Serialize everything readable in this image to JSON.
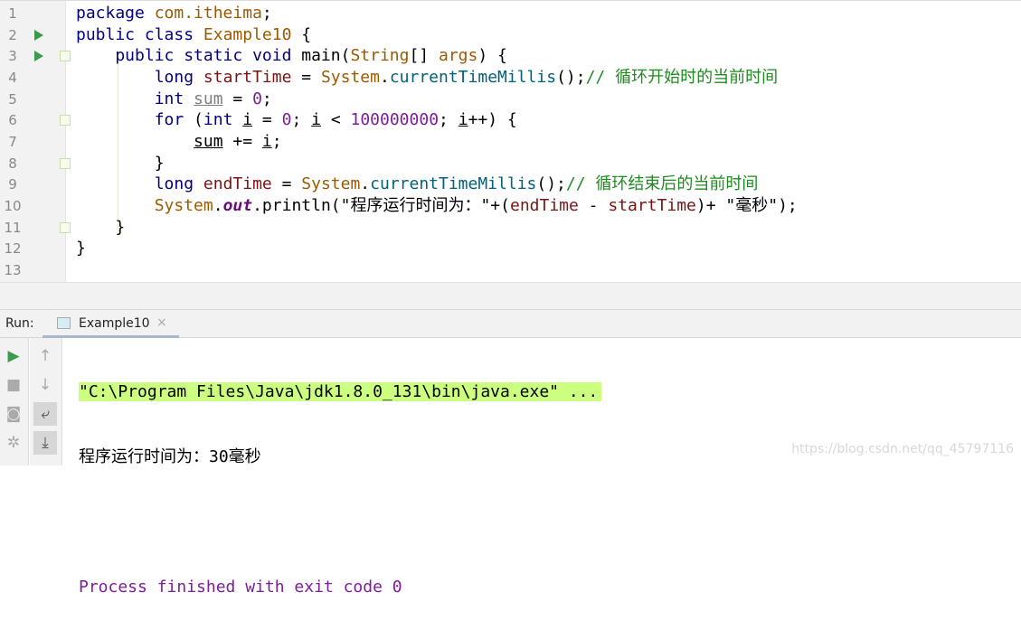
{
  "editor": {
    "line_numbers": [
      "1",
      "2",
      "3",
      "4",
      "5",
      "6",
      "7",
      "8",
      "9",
      "10",
      "11",
      "12",
      "13"
    ],
    "run_gutter_lines": [
      2,
      3
    ],
    "fold_lines": [
      3,
      6,
      8,
      11
    ],
    "lines": [
      [
        [
          "package ",
          "keyword"
        ],
        [
          "com.itheima",
          "type"
        ],
        [
          ";",
          "plain"
        ]
      ],
      [
        [
          "public class ",
          "keyword"
        ],
        [
          "Example10",
          "type"
        ],
        [
          " {",
          "plain"
        ]
      ],
      [
        [
          "    public static void ",
          "keyword"
        ],
        [
          "main(",
          "plain"
        ],
        [
          "String",
          "type"
        ],
        [
          "[] ",
          "plain"
        ],
        [
          "args",
          "type"
        ],
        [
          ") {",
          "plain"
        ]
      ],
      [
        [
          "        long ",
          "keyword"
        ],
        [
          "startTime",
          "var"
        ],
        [
          " = ",
          "plain"
        ],
        [
          "System",
          "type"
        ],
        [
          ".",
          "plain"
        ],
        [
          "currentTimeMillis",
          "method"
        ],
        [
          "();",
          "plain"
        ],
        [
          "// 循环开始时的当前时间",
          "comment"
        ]
      ],
      [
        [
          "        int ",
          "keyword"
        ],
        [
          "sum",
          "unused"
        ],
        [
          " = ",
          "plain"
        ],
        [
          "0",
          "num"
        ],
        [
          ";",
          "plain"
        ]
      ],
      [
        [
          "        for ",
          "keyword"
        ],
        [
          "(",
          "plain"
        ],
        [
          "int ",
          "keyword"
        ],
        [
          "i",
          "ul"
        ],
        [
          " = ",
          "plain"
        ],
        [
          "0",
          "num"
        ],
        [
          "; ",
          "plain"
        ],
        [
          "i",
          "ul"
        ],
        [
          " < ",
          "plain"
        ],
        [
          "100000000",
          "num"
        ],
        [
          "; ",
          "plain"
        ],
        [
          "i",
          "ul"
        ],
        [
          "++) {",
          "plain"
        ]
      ],
      [
        [
          "            ",
          "plain"
        ],
        [
          "sum",
          "ul"
        ],
        [
          " += ",
          "plain"
        ],
        [
          "i",
          "ul"
        ],
        [
          ";",
          "plain"
        ]
      ],
      [
        [
          "        }",
          "plain"
        ]
      ],
      [
        [
          "        long ",
          "keyword"
        ],
        [
          "endTime",
          "var"
        ],
        [
          " = ",
          "plain"
        ],
        [
          "System",
          "type"
        ],
        [
          ".",
          "plain"
        ],
        [
          "currentTimeMillis",
          "method"
        ],
        [
          "();",
          "plain"
        ],
        [
          "// 循环结束后的当前时间",
          "comment"
        ]
      ],
      [
        [
          "        ",
          "plain"
        ],
        [
          "System",
          "type"
        ],
        [
          ".",
          "plain"
        ],
        [
          "out",
          "field"
        ],
        [
          ".println(\"程序运行时间为：\"+(",
          "plain"
        ],
        [
          "endTime",
          "var"
        ],
        [
          " - ",
          "plain"
        ],
        [
          "startTime",
          "var"
        ],
        [
          ")+ \"毫秒\");",
          "plain"
        ]
      ],
      [
        [
          "    }",
          "plain"
        ]
      ],
      [
        [
          "}",
          "plain"
        ]
      ],
      [
        [
          "",
          "plain"
        ]
      ]
    ]
  },
  "run_panel": {
    "label": "Run:",
    "tab": {
      "label": "Example10",
      "close": "×"
    },
    "tools_left": [
      {
        "icon": "play-icon",
        "glyph": "▶"
      },
      {
        "icon": "stop-icon",
        "glyph": "■"
      },
      {
        "icon": "camera-icon",
        "glyph": "◙"
      },
      {
        "icon": "debug-icon",
        "glyph": "✲"
      }
    ],
    "tools_right": [
      {
        "icon": "arrow-up-icon",
        "glyph": "↑"
      },
      {
        "icon": "arrow-down-icon",
        "glyph": "↓"
      },
      {
        "icon": "soft-wrap-icon",
        "glyph": "⤶",
        "active": true
      },
      {
        "icon": "scroll-to-end-icon",
        "glyph": "⤓",
        "active": true
      }
    ],
    "console": {
      "command": "\"C:\\Program Files\\Java\\jdk1.8.0_131\\bin\\java.exe\" ...",
      "output": "程序运行时间为：30毫秒",
      "exit": "Process finished with exit code 0"
    }
  },
  "watermark": "https://blog.csdn.net/qq_45797116"
}
